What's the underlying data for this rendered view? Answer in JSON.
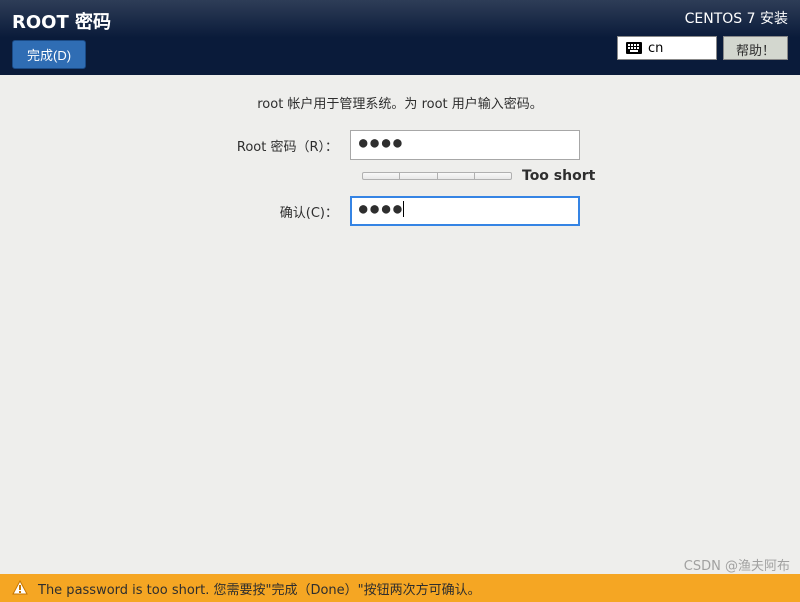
{
  "header": {
    "title": "ROOT 密码",
    "done_button": "完成(D)",
    "installer_title": "CENTOS 7 安装",
    "lang_code": "cn",
    "help_button": "帮助！"
  },
  "content": {
    "description": "root 帐户用于管理系统。为 root 用户输入密码。",
    "root_password_label": "Root 密码（R）：",
    "root_password_value": "●●●●",
    "confirm_label": "确认(C)：",
    "confirm_value": "●●●●",
    "strength_text": "Too short"
  },
  "warning": {
    "message": "The password is too short. 您需要按\"完成（Done）\"按钮两次方可确认。"
  },
  "watermark": "CSDN @渔夫阿布"
}
